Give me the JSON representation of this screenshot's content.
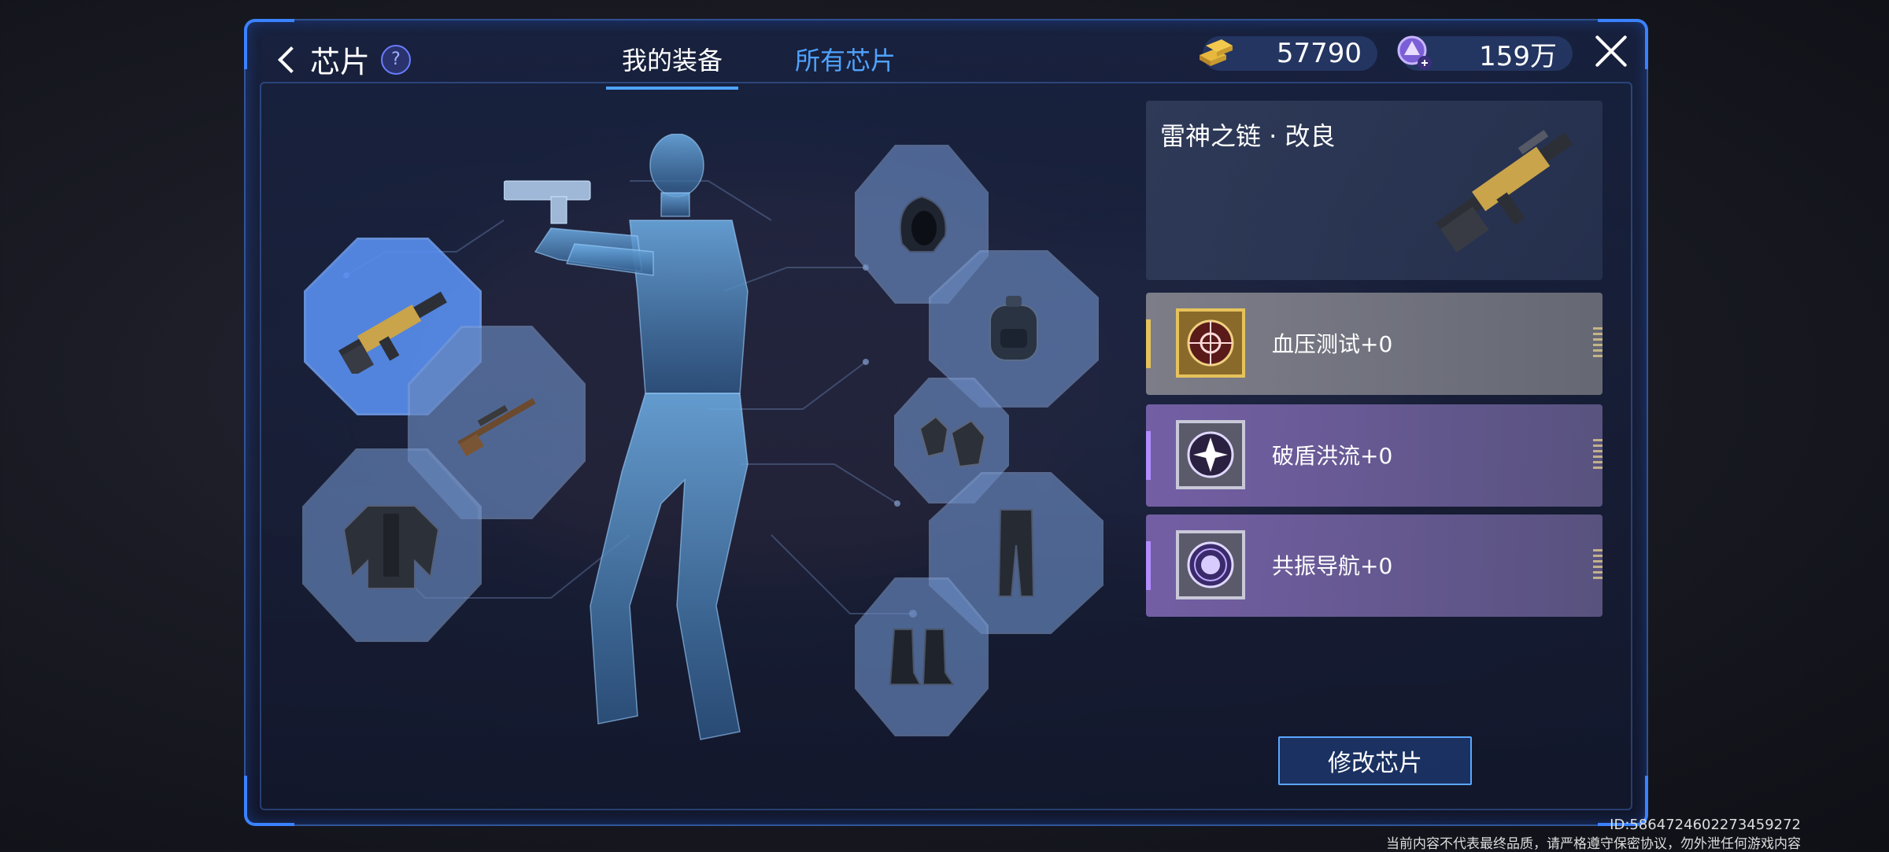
{
  "header": {
    "title": "芯片",
    "help_symbol": "?"
  },
  "tabs": [
    {
      "label": "我的装备",
      "active": true
    },
    {
      "label": "所有芯片",
      "active": false
    }
  ],
  "currencies": [
    {
      "icon": "gold-bars-icon",
      "value": "57790"
    },
    {
      "icon": "purple-crystal-add-icon",
      "value": "159万"
    }
  ],
  "equipment_slots": {
    "left": [
      "rifle-item-icon",
      "sniper-rifle-item-icon",
      "armor-jacket-item-icon"
    ],
    "right": [
      "hood-item-icon",
      "backpack-item-icon",
      "gloves-item-icon",
      "pants-item-icon",
      "boots-item-icon"
    ]
  },
  "selected_item": {
    "name": "雷神之链 · 改良",
    "icon": "rifle-icon"
  },
  "chips": [
    {
      "label": "血压测试+0",
      "rarity": "gold",
      "icon": "target-chip-icon"
    },
    {
      "label": "破盾洪流+0",
      "rarity": "purple",
      "icon": "burst-chip-icon"
    },
    {
      "label": "共振导航+0",
      "rarity": "purple",
      "icon": "orb-chip-icon"
    }
  ],
  "actions": {
    "modify_label": "修改芯片"
  },
  "footer": {
    "id_text": "ID:5864724602273459272",
    "notice": "当前内容不代表最终品质，请严格遵守保密协议，勿外泄任何游戏内容"
  },
  "colors": {
    "accent": "#4fa3ff",
    "gold": "#d8b24a",
    "purple": "#9d7de0"
  }
}
